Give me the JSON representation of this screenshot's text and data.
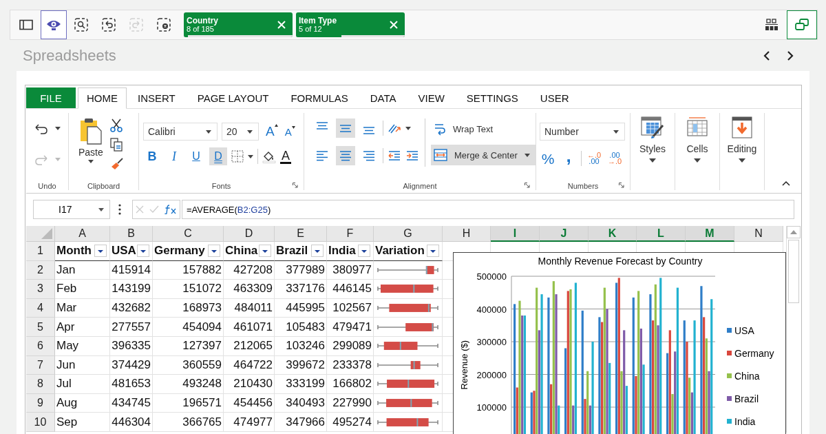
{
  "toolbar": {
    "buttons": [
      {
        "kind": "sidebar",
        "selected": false,
        "disabled": false
      },
      {
        "kind": "insights",
        "selected": true,
        "disabled": false
      },
      {
        "kind": "search",
        "selected": false,
        "disabled": false
      },
      {
        "kind": "back",
        "selected": false,
        "disabled": false
      },
      {
        "kind": "forward",
        "selected": false,
        "disabled": true
      },
      {
        "kind": "clear",
        "selected": false,
        "disabled": false
      }
    ],
    "filters": [
      {
        "field": "Country",
        "count": "8 of 185",
        "level": 0.04
      },
      {
        "field": "Item Type",
        "count": "5 of 12",
        "level": 0.42
      }
    ],
    "right_buttons": [
      {
        "kind": "grid",
        "selected": false
      },
      {
        "kind": "window",
        "selected": true
      }
    ]
  },
  "sheet_title": "Spreadsheets",
  "ribbon": {
    "tabs": [
      {
        "label": "FILE",
        "kind": "file",
        "selected": false
      },
      {
        "label": "HOME",
        "kind": "tab",
        "selected": true
      },
      {
        "label": "INSERT",
        "kind": "tab",
        "selected": false
      },
      {
        "label": "PAGE LAYOUT",
        "kind": "tab",
        "selected": false
      },
      {
        "label": "FORMULAS",
        "kind": "tab",
        "selected": false
      },
      {
        "label": "DATA",
        "kind": "tab",
        "selected": false
      },
      {
        "label": "VIEW",
        "kind": "tab",
        "selected": false
      },
      {
        "label": "SETTINGS",
        "kind": "tab",
        "selected": false
      },
      {
        "label": "USER",
        "kind": "tab",
        "selected": false
      }
    ],
    "undo": {
      "label": "Undo",
      "buttons": [
        {
          "kind": "undo",
          "disabled": false
        },
        {
          "kind": "redo",
          "disabled": true
        }
      ]
    },
    "clipboard": {
      "label": "Clipboard",
      "paste": "Paste"
    },
    "fonts": {
      "label": "Fonts",
      "font_name": "Calibri",
      "font_size": "20",
      "size_buttons": [
        {
          "kind": "grow",
          "label": "A"
        },
        {
          "kind": "shrink",
          "label": "A"
        }
      ],
      "style_buttons": [
        {
          "kind": "bold",
          "label": "B",
          "selected": false
        },
        {
          "kind": "italic",
          "label": "I",
          "selected": false
        },
        {
          "kind": "underline",
          "label": "U",
          "selected": false
        },
        {
          "kind": "double-underline",
          "label": "D",
          "selected": true
        }
      ],
      "font_color_label": "A"
    },
    "alignment": {
      "label": "Alignment",
      "vertical": [
        {
          "kind": "top",
          "selected": false
        },
        {
          "kind": "middle",
          "selected": true
        },
        {
          "kind": "bottom",
          "selected": false
        }
      ],
      "horizontal": [
        {
          "kind": "left",
          "selected": false
        },
        {
          "kind": "center",
          "selected": true
        },
        {
          "kind": "right",
          "selected": false
        }
      ],
      "wrap_text": {
        "label": "Wrap Text",
        "selected": false
      },
      "merge": {
        "label": "Merge & Center",
        "selected": true
      }
    },
    "numbers": {
      "label": "Numbers",
      "format": "Number",
      "buttons": [
        {
          "kind": "percent",
          "lines": [
            "%"
          ]
        },
        {
          "kind": "comma",
          "lines": [
            ","
          ]
        },
        {
          "kind": "increase-decimal",
          "lines": [
            "←.0",
            ".00"
          ]
        },
        {
          "kind": "decrease-decimal",
          "lines": [
            ".00",
            "→.0"
          ]
        }
      ]
    },
    "big_buttons": [
      {
        "kind": "styles",
        "label": "Styles"
      },
      {
        "kind": "cells",
        "label": "Cells"
      },
      {
        "kind": "editing",
        "label": "Editing"
      }
    ]
  },
  "formula_bar": {
    "cell": "I17",
    "formula": [
      {
        "kind": "plain",
        "text": "=AVERAGE("
      },
      {
        "kind": "reference",
        "text": "B2:G25"
      },
      {
        "kind": "plain",
        "text": ")"
      }
    ]
  },
  "grid": {
    "columns": [
      {
        "label": "A",
        "selected": false
      },
      {
        "label": "B",
        "selected": false
      },
      {
        "label": "C",
        "selected": false
      },
      {
        "label": "D",
        "selected": false
      },
      {
        "label": "E",
        "selected": false
      },
      {
        "label": "F",
        "selected": false
      },
      {
        "label": "G",
        "selected": false
      },
      {
        "label": "H",
        "selected": false
      },
      {
        "label": "I",
        "selected": true
      },
      {
        "label": "J",
        "selected": true
      },
      {
        "label": "K",
        "selected": true
      },
      {
        "label": "L",
        "selected": true
      },
      {
        "label": "M",
        "selected": true
      },
      {
        "label": "N",
        "selected": false
      }
    ],
    "header": {
      "number": "1",
      "cells": [
        "Month",
        "USA",
        "Germany",
        "China",
        "Brazil",
        "India",
        "Variation"
      ]
    },
    "rows": [
      {
        "number": "2",
        "cells": [
          "Jan",
          "415914",
          "157882",
          "427208",
          "377989",
          "380977"
        ]
      },
      {
        "number": "3",
        "cells": [
          "Feb",
          "143199",
          "151072",
          "463309",
          "337176",
          "446145"
        ]
      },
      {
        "number": "4",
        "cells": [
          "Mar",
          "432682",
          "168973",
          "484011",
          "445995",
          "102567"
        ]
      },
      {
        "number": "5",
        "cells": [
          "Apr",
          "277557",
          "454094",
          "461071",
          "105483",
          "479471"
        ]
      },
      {
        "number": "6",
        "cells": [
          "May",
          "396335",
          "127397",
          "212065",
          "103246",
          "299089"
        ]
      },
      {
        "number": "7",
        "cells": [
          "Jun",
          "374429",
          "360559",
          "464722",
          "399672",
          "233378"
        ]
      },
      {
        "number": "8",
        "cells": [
          "Jul",
          "481653",
          "493248",
          "210430",
          "333199",
          "166802"
        ]
      },
      {
        "number": "9",
        "cells": [
          "Aug",
          "434745",
          "196571",
          "454456",
          "340493",
          "227990"
        ]
      },
      {
        "number": "10",
        "cells": [
          "Sep",
          "446304",
          "366765",
          "474977",
          "347966",
          "495274"
        ]
      }
    ]
  },
  "chart": {
    "chart_data": {
      "type": "bar",
      "title": "Monthly Revenue Forecast by Country",
      "ylabel": "Revenue ($)",
      "ylim": [
        0,
        500000
      ],
      "yticks": [
        100000,
        200000,
        300000,
        400000,
        500000
      ],
      "grid": true,
      "legend": true,
      "series": [
        {
          "name": "USA",
          "color": "#2f7ec8",
          "values": [
            415000,
            145000,
            435000,
            280000,
            395000,
            375000,
            480000,
            435000,
            445000,
            265000,
            365000,
            470000
          ]
        },
        {
          "name": "Germany",
          "color": "#d9473d",
          "values": [
            160000,
            150000,
            170000,
            455000,
            125000,
            360000,
            495000,
            195000,
            365000,
            335000,
            300000,
            375000
          ]
        },
        {
          "name": "China",
          "color": "#95c14c",
          "values": [
            425000,
            465000,
            485000,
            460000,
            210000,
            465000,
            210000,
            455000,
            475000,
            140000,
            190000,
            310000
          ]
        },
        {
          "name": "Brazil",
          "color": "#7f5ba8",
          "values": [
            380000,
            335000,
            445000,
            105000,
            105000,
            400000,
            335000,
            340000,
            350000,
            270000,
            145000,
            210000
          ]
        },
        {
          "name": "India",
          "color": "#22b2d0",
          "values": [
            380000,
            445000,
            105000,
            480000,
            300000,
            235000,
            165000,
            230000,
            495000,
            465000,
            365000,
            430000
          ]
        }
      ]
    }
  }
}
